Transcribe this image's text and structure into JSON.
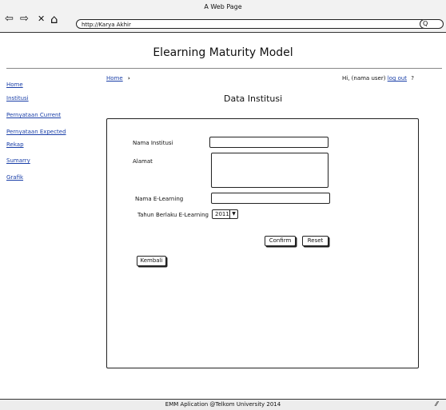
{
  "browser": {
    "window_title": "A Web Page",
    "url": "http://Karya Akhir",
    "back_glyph": "⇦",
    "forward_glyph": "⇨",
    "close_glyph": "✕",
    "home_glyph": "⌂",
    "search_glyph": "Q",
    "icons": [
      "back-icon",
      "forward-icon",
      "close-icon",
      "home-icon",
      "search-icon"
    ]
  },
  "app": {
    "title": "Elearning Maturity Model"
  },
  "breadcrumb": {
    "home_label": "Home",
    "separator": "›"
  },
  "user": {
    "greeting": "Hi, (nama user)",
    "logout_label": "log out",
    "help_label": "?"
  },
  "sidebar": {
    "items": [
      {
        "label": "Home"
      },
      {
        "label": "Institusi"
      },
      {
        "label": "Pernyataan Current"
      },
      {
        "label": "Pernyataan Expected"
      },
      {
        "label": "Rekap"
      },
      {
        "label": "Sumarry"
      },
      {
        "label": "Grafik"
      }
    ]
  },
  "form": {
    "section_title": "Data Institusi",
    "nama_institusi_label": "Nama Institusi",
    "nama_institusi_value": "",
    "alamat_label": "Alamat",
    "alamat_value": "",
    "nama_elearning_label": "Nama E-Learning",
    "nama_elearning_value": "",
    "tahun_label": "Tahun Berlaku E-Learning",
    "tahun_value": "2011",
    "confirm_label": "Confirm",
    "reset_label": "Reset",
    "back_label": "Kembali"
  },
  "footer": {
    "text": "EMM Aplication @Telkom University 2014",
    "resize_glyph": "⁄⁄"
  }
}
